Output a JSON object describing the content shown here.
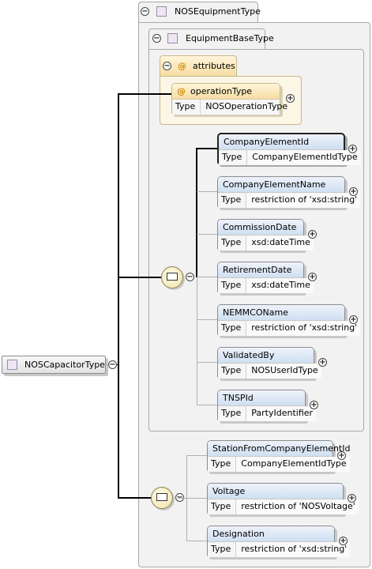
{
  "root": {
    "label": "NOSCapacitorType"
  },
  "outer_type": {
    "label": "NOSEquipmentType"
  },
  "base_type": {
    "label": "EquipmentBaseType"
  },
  "attributes": {
    "group_label": "attributes",
    "items": [
      {
        "name": "operationType",
        "type_key": "Type",
        "type_value": "NOSOperationType"
      }
    ]
  },
  "sequence1": [
    {
      "name": "CompanyElementId",
      "type_key": "Type",
      "type_value": "CompanyElementIdType"
    },
    {
      "name": "CompanyElementName",
      "type_key": "Type",
      "type_value": "restriction of 'xsd:string'"
    },
    {
      "name": "CommissionDate",
      "type_key": "Type",
      "type_value": "xsd:dateTime"
    },
    {
      "name": "RetirementDate",
      "type_key": "Type",
      "type_value": "xsd:dateTime"
    },
    {
      "name": "NEMMCOName",
      "type_key": "Type",
      "type_value": "restriction of 'xsd:string'"
    },
    {
      "name": "ValidatedBy",
      "type_key": "Type",
      "type_value": "NOSUserIdType"
    },
    {
      "name": "TNSPId",
      "type_key": "Type",
      "type_value": "PartyIdentifier"
    }
  ],
  "sequence2": [
    {
      "name": "StationFromCompanyElementId",
      "type_key": "Type",
      "type_value": "CompanyElementIdType"
    },
    {
      "name": "Voltage",
      "type_key": "Type",
      "type_value": "restriction of 'NOSVoltage'"
    },
    {
      "name": "Designation",
      "type_key": "Type",
      "type_value": "restriction of 'xsd:string'"
    }
  ],
  "symbols": {
    "collapse": "−",
    "expand": "+",
    "attribute": "@"
  },
  "colors": {
    "element_header": "#cfdff2",
    "attribute_header": "#f6dca0",
    "sequence": "#efe2a8",
    "panel": "#f2f2f2"
  }
}
